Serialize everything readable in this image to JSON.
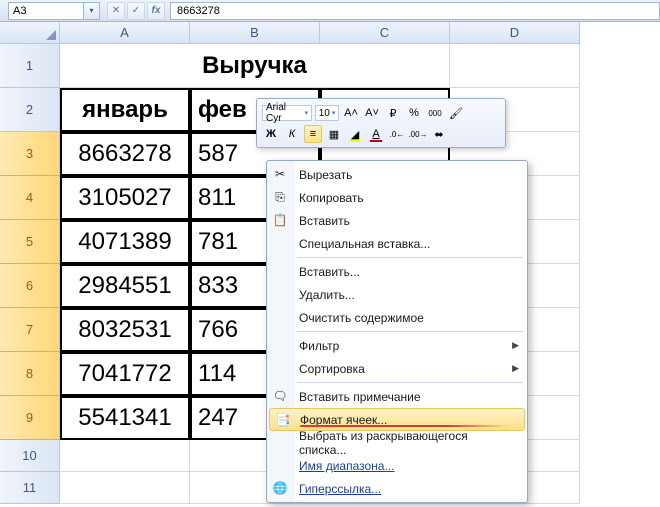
{
  "namebox": "A3",
  "formula": "8663278",
  "columns": [
    "A",
    "B",
    "C",
    "D"
  ],
  "rows_labels": [
    "1",
    "2",
    "3",
    "4",
    "5",
    "6",
    "7",
    "8",
    "9",
    "10",
    "11"
  ],
  "title": "Выручка",
  "headers": {
    "a": "январь",
    "b": "фев",
    "c": ""
  },
  "data": {
    "a": [
      "8663278",
      "3105027",
      "4071389",
      "2984551",
      "8032531",
      "7041772",
      "5541341"
    ],
    "b": [
      "587",
      "811",
      "781",
      "833",
      "766",
      "114",
      "247"
    ],
    "c": [
      "",
      "",
      "",
      "",
      "",
      "",
      ""
    ]
  },
  "mini": {
    "font": "Arial Cyr",
    "size": "10"
  },
  "menu": {
    "cut": "Вырезать",
    "copy": "Копировать",
    "paste": "Вставить",
    "paste_special": "Специальная вставка...",
    "insert": "Вставить...",
    "delete": "Удалить...",
    "clear": "Очистить содержимое",
    "filter": "Фильтр",
    "sort": "Сортировка",
    "comment": "Вставить примечание",
    "format_cells": "Формат ячеек...",
    "pick_list": "Выбрать из раскрывающегося списка...",
    "range_name": "Имя диапазона...",
    "hyperlink": "Гиперссылка..."
  }
}
